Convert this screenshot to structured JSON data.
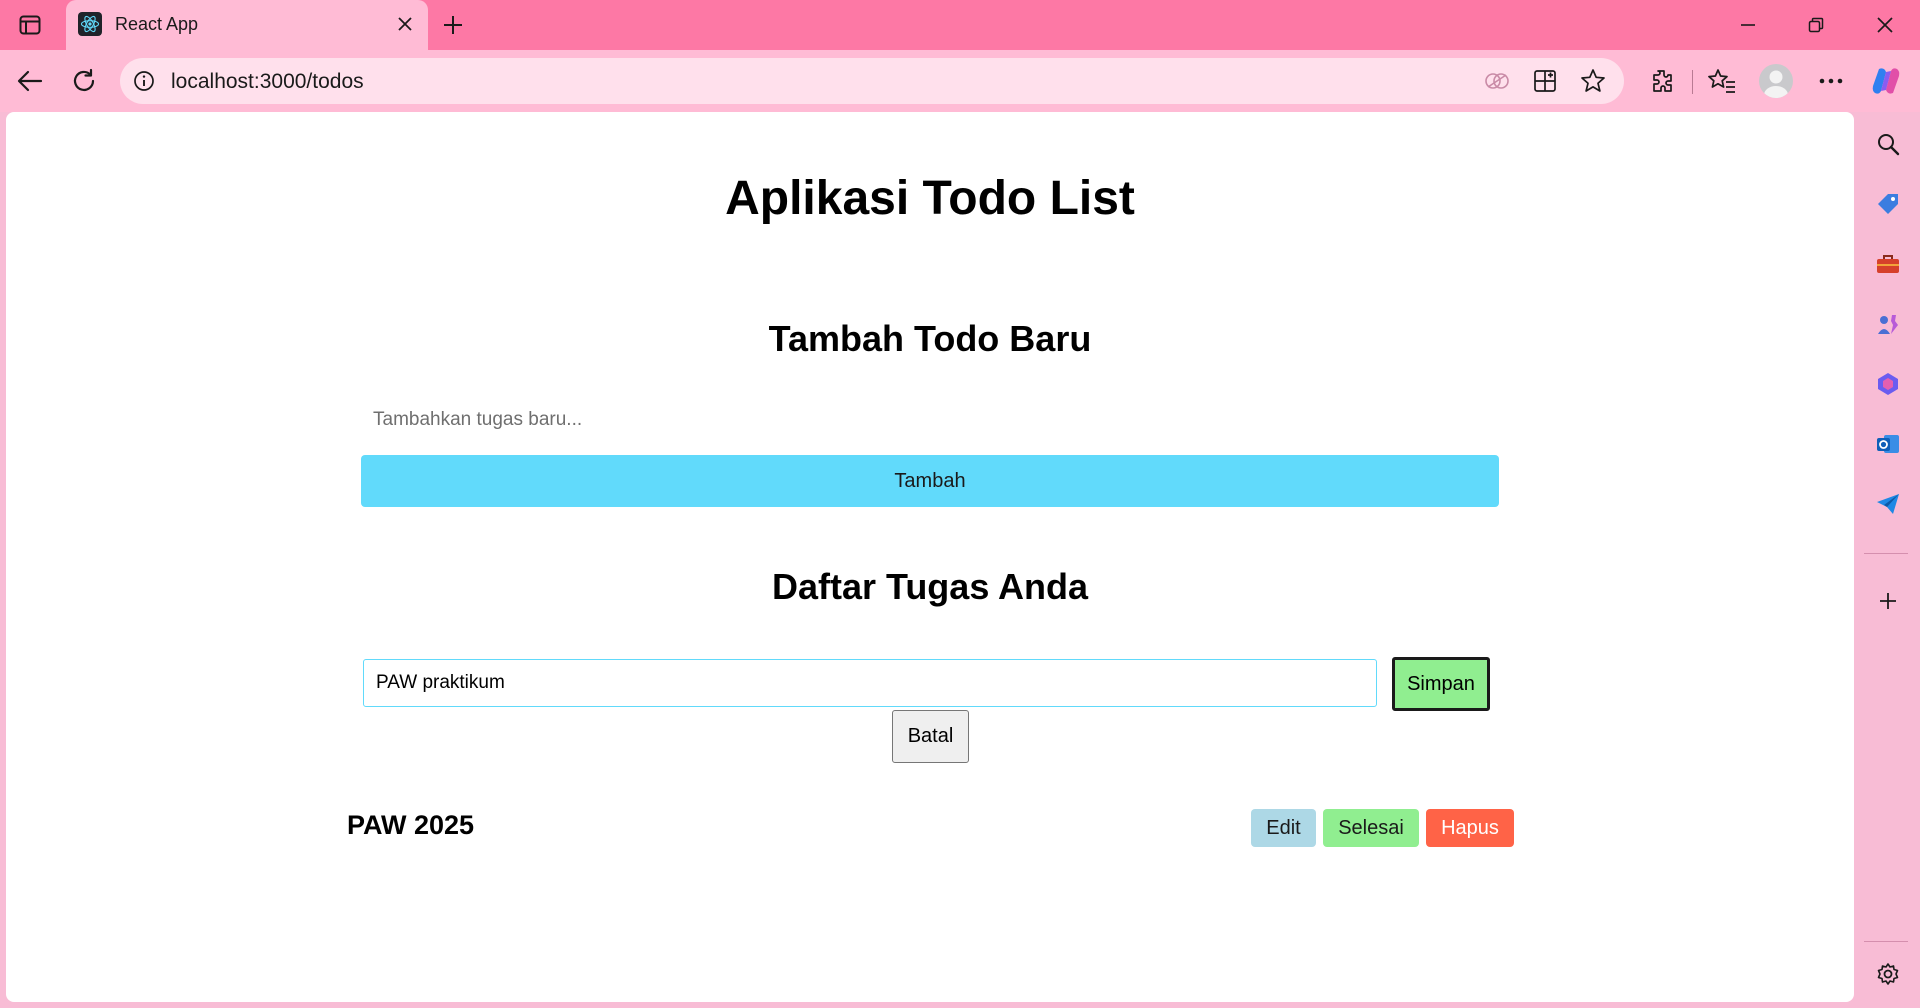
{
  "browser": {
    "tab_title": "React App",
    "url": "localhost:3000/todos"
  },
  "page": {
    "title": "Aplikasi Todo List",
    "add_section": {
      "heading": "Tambah Todo Baru",
      "input_placeholder": "Tambahkan tugas baru...",
      "button_label": "Tambah"
    },
    "list_section": {
      "heading": "Daftar Tugas Anda",
      "edit_value": "PAW praktikum",
      "save_label": "Simpan",
      "cancel_label": "Batal",
      "todos": [
        {
          "text": "PAW 2025",
          "edit_label": "Edit",
          "done_label": "Selesai",
          "delete_label": "Hapus"
        }
      ]
    }
  },
  "colors": {
    "title_bar": "#fd78a5",
    "toolbar": "#ffbbd5",
    "accent_button": "#61dafb",
    "save_button": "#90ee90",
    "edit_button": "#add8e6",
    "done_button": "#90ee90",
    "delete_button": "#ff6347"
  },
  "icons": {
    "sidebar": [
      "search-icon",
      "tag-icon",
      "toolbox-icon",
      "games-icon",
      "copilot-icon",
      "outlook-icon",
      "send-icon",
      "add-icon",
      "settings-icon"
    ]
  }
}
